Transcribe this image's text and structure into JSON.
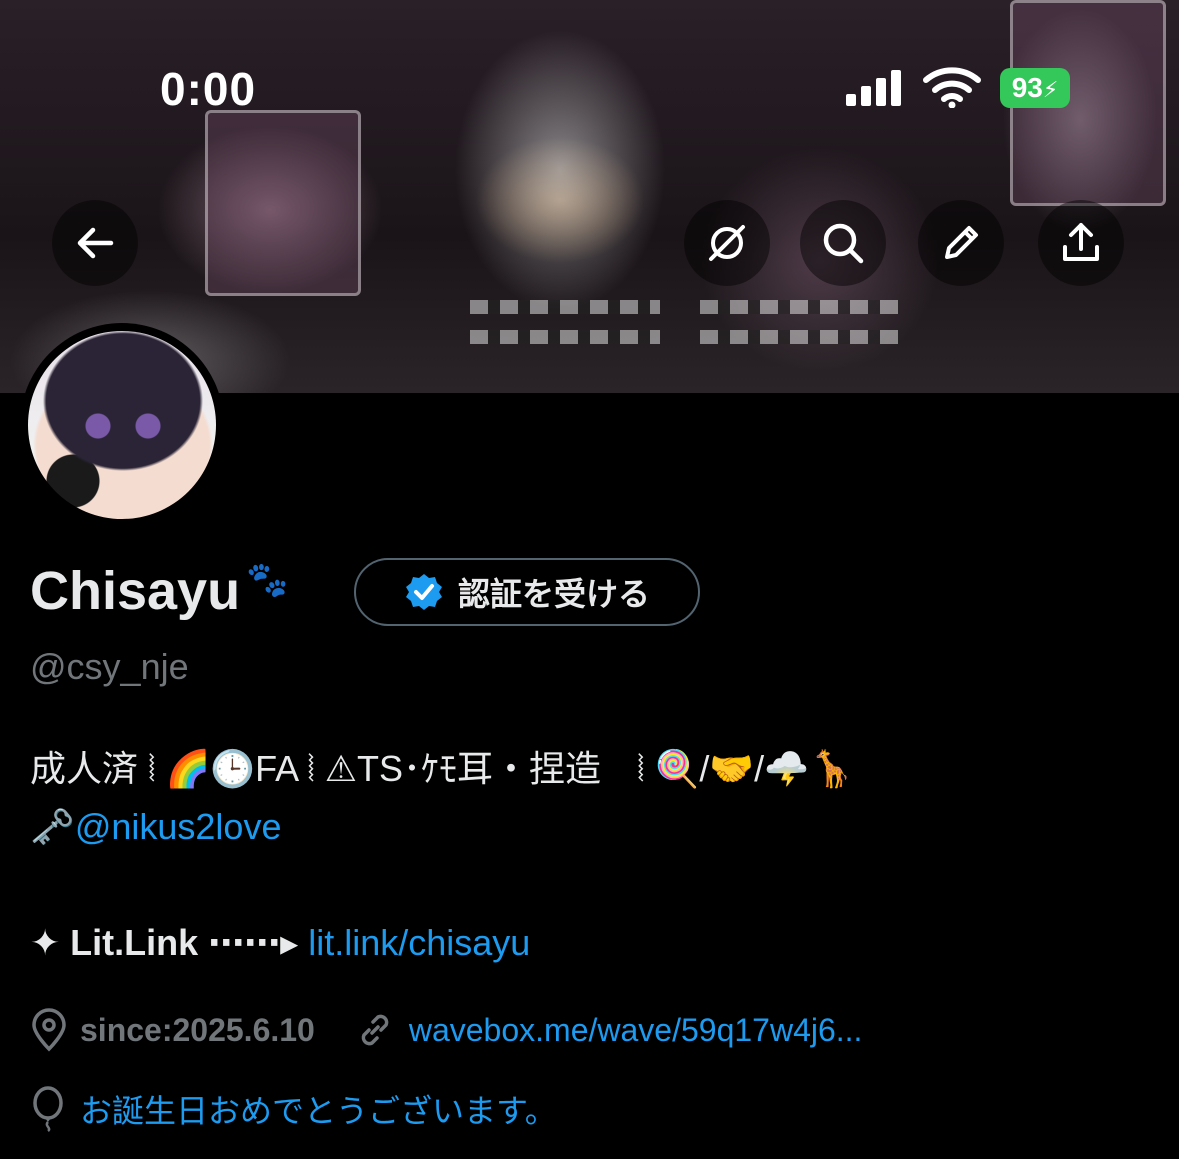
{
  "status_bar": {
    "time": "0:00",
    "battery": "93",
    "icons": [
      "signal-icon",
      "wifi-icon",
      "battery-charging-icon"
    ]
  },
  "header": {
    "buttons": [
      "back-arrow-icon",
      "grok-icon",
      "search-icon",
      "edit-icon",
      "share-icon"
    ]
  },
  "profile": {
    "display_name": "Chisayu",
    "name_emoji": "🐾",
    "verify_label": "認証を受ける",
    "handle": "@csy_nje",
    "bio_line1": "成人済 ⦚ 🌈🕒FA ⦚ ⚠TS･ｹﾓ耳・捏造　⦚ 🍭/🤝/🌩️🦒",
    "bio_line2_emoji": "🗝️",
    "bio_mention": "@nikus2love",
    "litlink_label": "✦ Lit.Link ⋯⋯▸",
    "litlink_url": "lit.link/chisayu",
    "location": "since:2025.6.10",
    "website": "wavebox.me/wave/59q17w4j6...",
    "birthday": "お誕生日おめでとうございます。"
  },
  "colors": {
    "background": "#000000",
    "text": "#e7e9ea",
    "muted": "#71767b",
    "link": "#1d9bf0",
    "battery": "#34c759"
  }
}
